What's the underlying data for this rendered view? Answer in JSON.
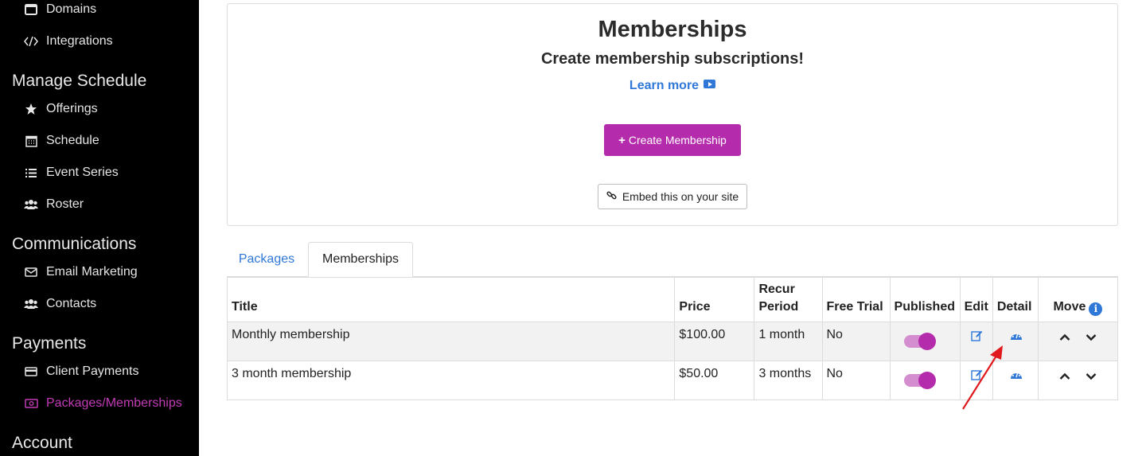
{
  "sidebar": {
    "items_top": [
      {
        "label": "Domains"
      },
      {
        "label": "Integrations"
      }
    ],
    "sections": [
      {
        "title": "Manage Schedule"
      },
      {
        "title": "Communications"
      },
      {
        "title": "Payments"
      },
      {
        "title": "Account"
      }
    ],
    "schedule_items": [
      {
        "label": "Offerings"
      },
      {
        "label": "Schedule"
      },
      {
        "label": "Event Series"
      },
      {
        "label": "Roster"
      }
    ],
    "comm_items": [
      {
        "label": "Email Marketing"
      },
      {
        "label": "Contacts"
      }
    ],
    "payment_items": [
      {
        "label": "Client Payments"
      },
      {
        "label": "Packages/Memberships"
      }
    ]
  },
  "header": {
    "title": "Memberships",
    "subtitle": "Create membership subscriptions!",
    "learn_more": "Learn more",
    "create_button": "Create Membership",
    "embed_button": "Embed this on your site"
  },
  "tabs": [
    {
      "label": "Packages"
    },
    {
      "label": "Memberships"
    }
  ],
  "table": {
    "headers": {
      "title": "Title",
      "price": "Price",
      "recur_line1": "Recur",
      "recur_line2": "Period",
      "free_trial": "Free Trial",
      "published": "Published",
      "edit": "Edit",
      "detail": "Detail",
      "move": "Move"
    },
    "rows": [
      {
        "title": "Monthly membership",
        "price": "$100.00",
        "recur": "1 month",
        "free_trial": "No",
        "published": true
      },
      {
        "title": "3 month membership",
        "price": "$50.00",
        "recur": "3 months",
        "free_trial": "No",
        "published": true
      }
    ]
  },
  "colors": {
    "accent": "#b42cab",
    "link": "#2f78d8",
    "sidebar_bg": "#000000",
    "annotation_arrow": "#e0191e"
  }
}
